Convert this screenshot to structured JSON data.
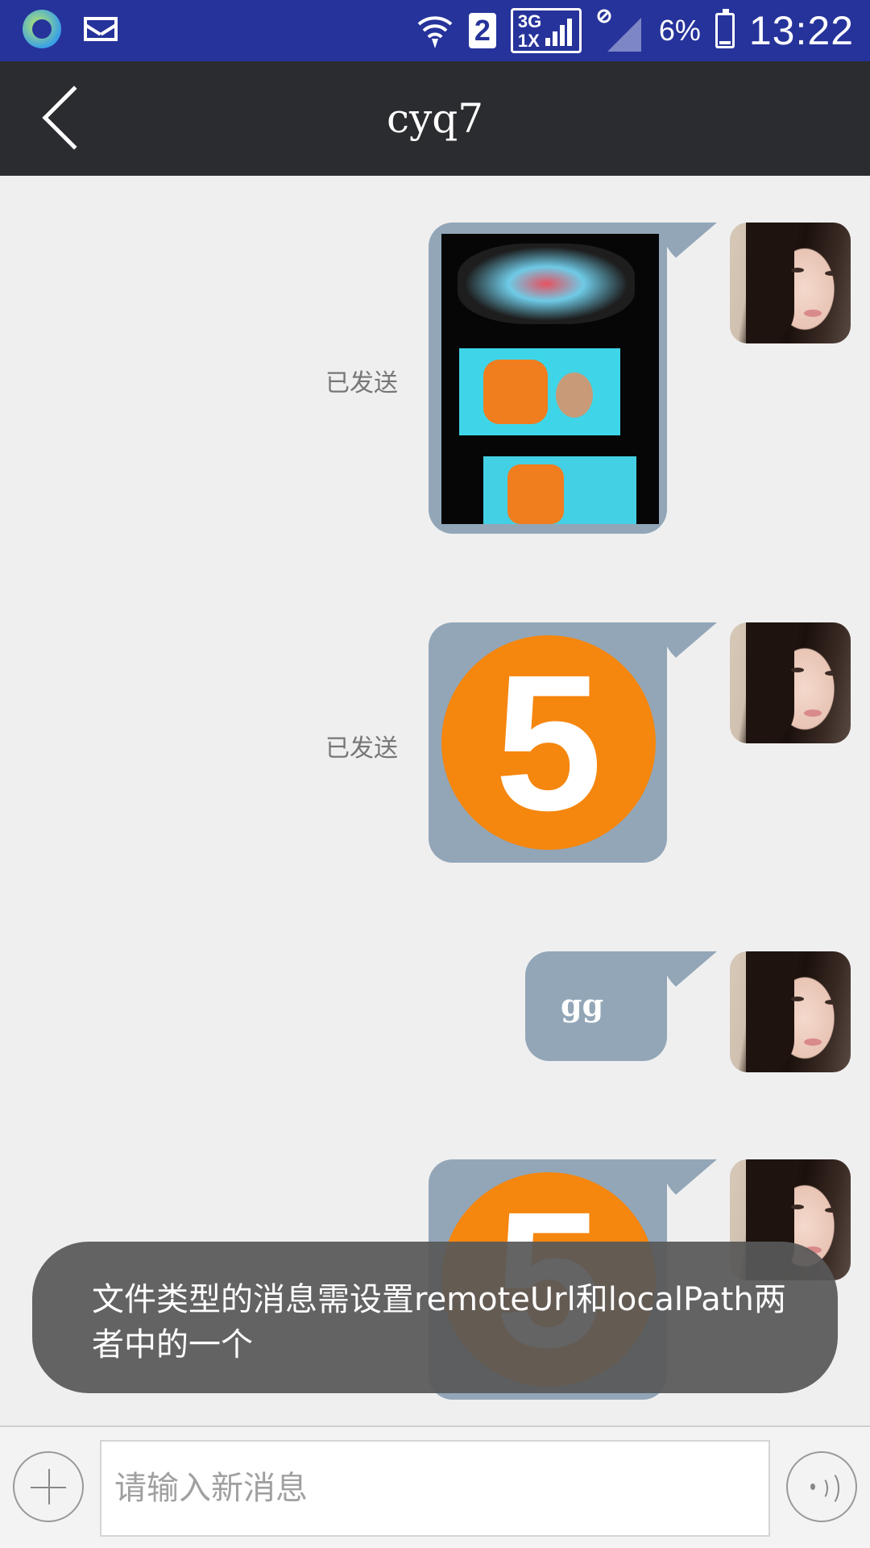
{
  "status_bar": {
    "sim_slot": "2",
    "network_top": "3G",
    "network_bottom": "1X",
    "battery": "6%",
    "time": "13:22",
    "icons": [
      "sync-icon",
      "mail-icon",
      "wifi-icon",
      "signal-icon",
      "no-signal-icon",
      "battery-charging-icon"
    ]
  },
  "header": {
    "title": "cyq7",
    "back_icon": "chevron-left-icon"
  },
  "messages": [
    {
      "type": "image",
      "status": "已发送"
    },
    {
      "type": "image",
      "status": "已发送"
    },
    {
      "type": "text",
      "text": "gg"
    },
    {
      "type": "image",
      "status": ""
    }
  ],
  "toast": {
    "text": "文件类型的消息需设置remoteUrl和localPath两者中的一个"
  },
  "composer": {
    "placeholder": "请输入新消息",
    "value": "",
    "add_icon": "plus-icon",
    "voice_icon": "voice-icon"
  },
  "colors": {
    "status_bar": "#26339b",
    "title_bar": "#2b2c30",
    "bubble": "#92a6b8",
    "background": "#efefef",
    "badge": "#f5860e"
  }
}
